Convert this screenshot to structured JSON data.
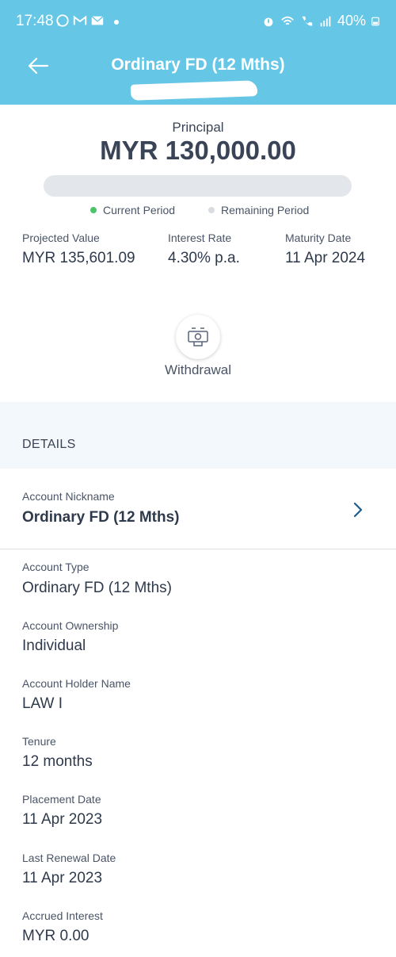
{
  "status_bar": {
    "time": "17:48",
    "battery": "40%",
    "icons": [
      "whatsapp-icon",
      "gmail-icon",
      "mail-icon",
      "alarm-icon",
      "wifi-icon",
      "call-icon",
      "signal-icon",
      "battery-icon"
    ]
  },
  "header": {
    "title": "Ordinary FD (12 Mths)",
    "back_icon": "arrow-left-icon",
    "background": "#66c6e6"
  },
  "summary": {
    "principal_label": "Principal",
    "principal_value": "MYR 130,000.00",
    "progress_fraction": 0.0,
    "legend_current": "Current Period",
    "legend_remaining": "Remaining Period",
    "current_color": "#4cc46a",
    "remaining_color": "#d8dbe0",
    "projected_label": "Projected Value",
    "projected_value": "MYR 135,601.09",
    "rate_label": "Interest Rate",
    "rate_value": "4.30% p.a.",
    "maturity_label": "Maturity Date",
    "maturity_value": "11 Apr 2024"
  },
  "actions": {
    "withdrawal_label": "Withdrawal",
    "withdrawal_icon": "cash-withdrawal-icon"
  },
  "details": {
    "section_title": "DETAILS",
    "nickname_label": "Account Nickname",
    "nickname_value": "Ordinary FD (12 Mths)",
    "fields": [
      {
        "label": "Account Type",
        "value": "Ordinary FD (12 Mths)"
      },
      {
        "label": "Account Ownership",
        "value": "Individual"
      },
      {
        "label": "Account Holder Name",
        "value": "LAW I"
      },
      {
        "label": "Tenure",
        "value": "12 months"
      },
      {
        "label": "Placement Date",
        "value": "11 Apr 2023"
      },
      {
        "label": "Last Renewal Date",
        "value": "11 Apr 2023"
      },
      {
        "label": "Accrued Interest",
        "value": "MYR 0.00"
      }
    ]
  }
}
